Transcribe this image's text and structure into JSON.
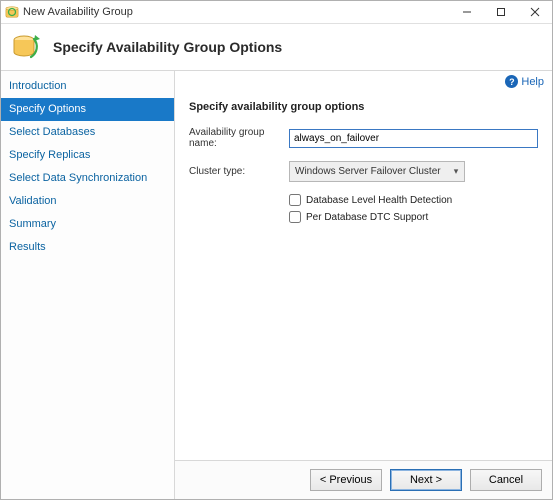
{
  "window": {
    "title": "New Availability Group"
  },
  "header": {
    "title": "Specify Availability Group Options"
  },
  "help": {
    "label": "Help"
  },
  "sidebar": {
    "items": [
      {
        "label": "Introduction"
      },
      {
        "label": "Specify Options"
      },
      {
        "label": "Select Databases"
      },
      {
        "label": "Specify Replicas"
      },
      {
        "label": "Select Data Synchronization"
      },
      {
        "label": "Validation"
      },
      {
        "label": "Summary"
      },
      {
        "label": "Results"
      }
    ],
    "active_index": 1
  },
  "form": {
    "section_heading": "Specify availability group options",
    "name_label": "Availability group name:",
    "name_value": "always_on_failover",
    "cluster_label": "Cluster type:",
    "cluster_value": "Windows Server Failover Cluster",
    "checkbox1_label": "Database Level Health Detection",
    "checkbox1_checked": false,
    "checkbox2_label": "Per Database DTC Support",
    "checkbox2_checked": false
  },
  "buttons": {
    "previous": "< Previous",
    "next": "Next >",
    "cancel": "Cancel"
  }
}
